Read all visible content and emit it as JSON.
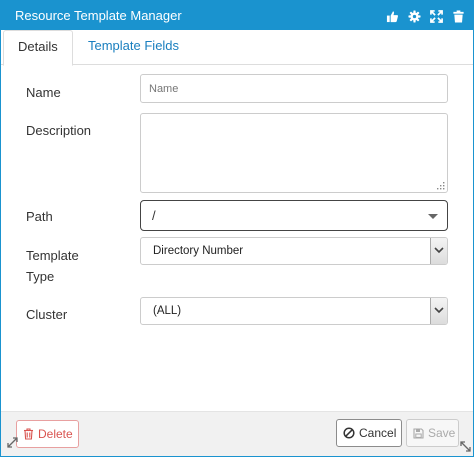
{
  "window": {
    "title": "Resource Template Manager",
    "title_icons": [
      "thumbs-up-icon",
      "gear-icon",
      "expand-icon",
      "trash-icon"
    ],
    "accent_color": "#1a93cf"
  },
  "tabs": [
    {
      "label": "Details",
      "active": true
    },
    {
      "label": "Template Fields",
      "active": false
    }
  ],
  "form": {
    "name": {
      "label": "Name",
      "value": "",
      "placeholder": "Name"
    },
    "description": {
      "label": "Description",
      "value": ""
    },
    "path": {
      "label": "Path",
      "value": "/"
    },
    "template_type": {
      "label_line1": "Template",
      "label_line2": "Type",
      "value": "Directory Number"
    },
    "cluster": {
      "label": "Cluster",
      "value": "(ALL)"
    }
  },
  "footer": {
    "delete_label": "Delete",
    "cancel_label": "Cancel",
    "save_label": "Save",
    "delete_color": "#d9534f"
  }
}
